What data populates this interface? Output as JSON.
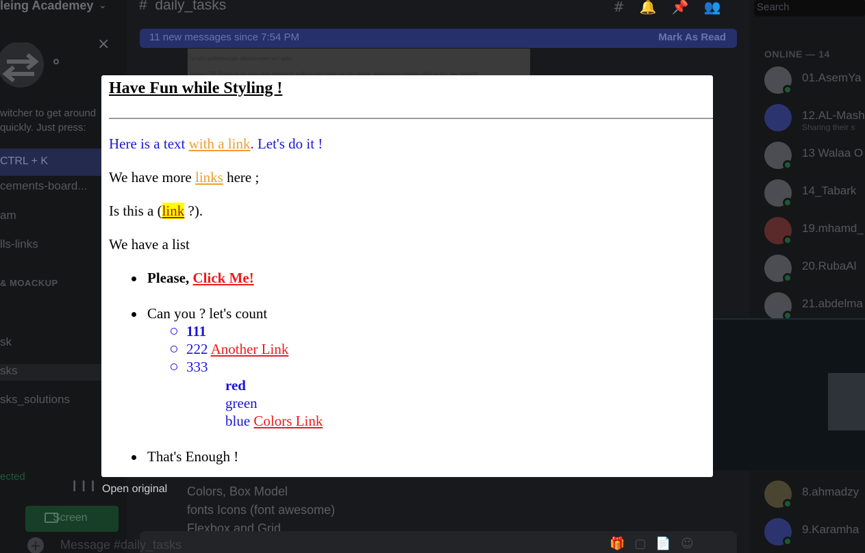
{
  "background": {
    "server_name": "leing Academey",
    "switcher_text_1": "witcher to get around",
    "switcher_text_2": "quickly. Just press:",
    "switcher_key": "CTRL + K",
    "channels": [
      "cements-board...",
      "am",
      "lls-links",
      "& MOACKUP",
      "sk",
      "sks",
      "sks_solutions"
    ],
    "voice_status": "ected",
    "screen_button": "Screen",
    "channel_header": "daily_tasks",
    "new_messages": "11 new messages since 7:54 PM",
    "mark_read": "Mark As Read",
    "preview_text_1": "iaculis pellentesque ullamcorper sed quis.",
    "preview_text_2": "Inline CSS Etiam in ex quis eros hendrerit sollicitudin vitae iaculis neque. Vestibulum ornare nibh lectus, nec blandit",
    "message_lines": [
      "Colors, Box Model",
      " fonts Icons (font awesome)",
      "Flexbox and Grid"
    ],
    "composer_placeholder": "Message #daily_tasks",
    "search_placeholder": "Search",
    "online_header": "ONLINE — 14",
    "members": [
      {
        "name": "01.AsemYa",
        "sub": ""
      },
      {
        "name": "12.AL-Mash",
        "sub": "Sharing their s"
      },
      {
        "name": "13 Walaa O",
        "sub": ""
      },
      {
        "name": "14_Tabark",
        "sub": ""
      },
      {
        "name": "19.mhamd_",
        "sub": ""
      },
      {
        "name": "20.RubaAl",
        "sub": ""
      },
      {
        "name": "21.abdelma",
        "sub": ""
      },
      {
        "name": "8.ahmadzy",
        "sub": ""
      },
      {
        "name": "9.Karamha",
        "sub": ""
      }
    ]
  },
  "popup": {
    "title": "Have Fun while Styling !",
    "line1": {
      "pre": "Here is a text ",
      "link": "with a link",
      "post": ". Let's do it !"
    },
    "line2": {
      "pre": "We have more ",
      "link": "links",
      "post": " here ;"
    },
    "line3": {
      "pre": "Is this a (",
      "link": "link",
      "post": " ?)."
    },
    "line4": "We have a list",
    "item1": {
      "pre": "Please, ",
      "link": "Click Me!"
    },
    "item2": "Can you ? let's count",
    "sub1": "111",
    "sub2": {
      "pre": "222 ",
      "link": "Another Link"
    },
    "sub3": "333",
    "colors": {
      "red": "red",
      "green": "green",
      "blue_pre": "blue ",
      "link": "Colors Link"
    },
    "item3": "That's Enough !"
  },
  "open_original": "Open original",
  "colors": {
    "blue_text": "#1c14d8",
    "orange_link": "#ee9d2f",
    "red_link": "#ee1a1a",
    "highlight": "#ffff00"
  }
}
